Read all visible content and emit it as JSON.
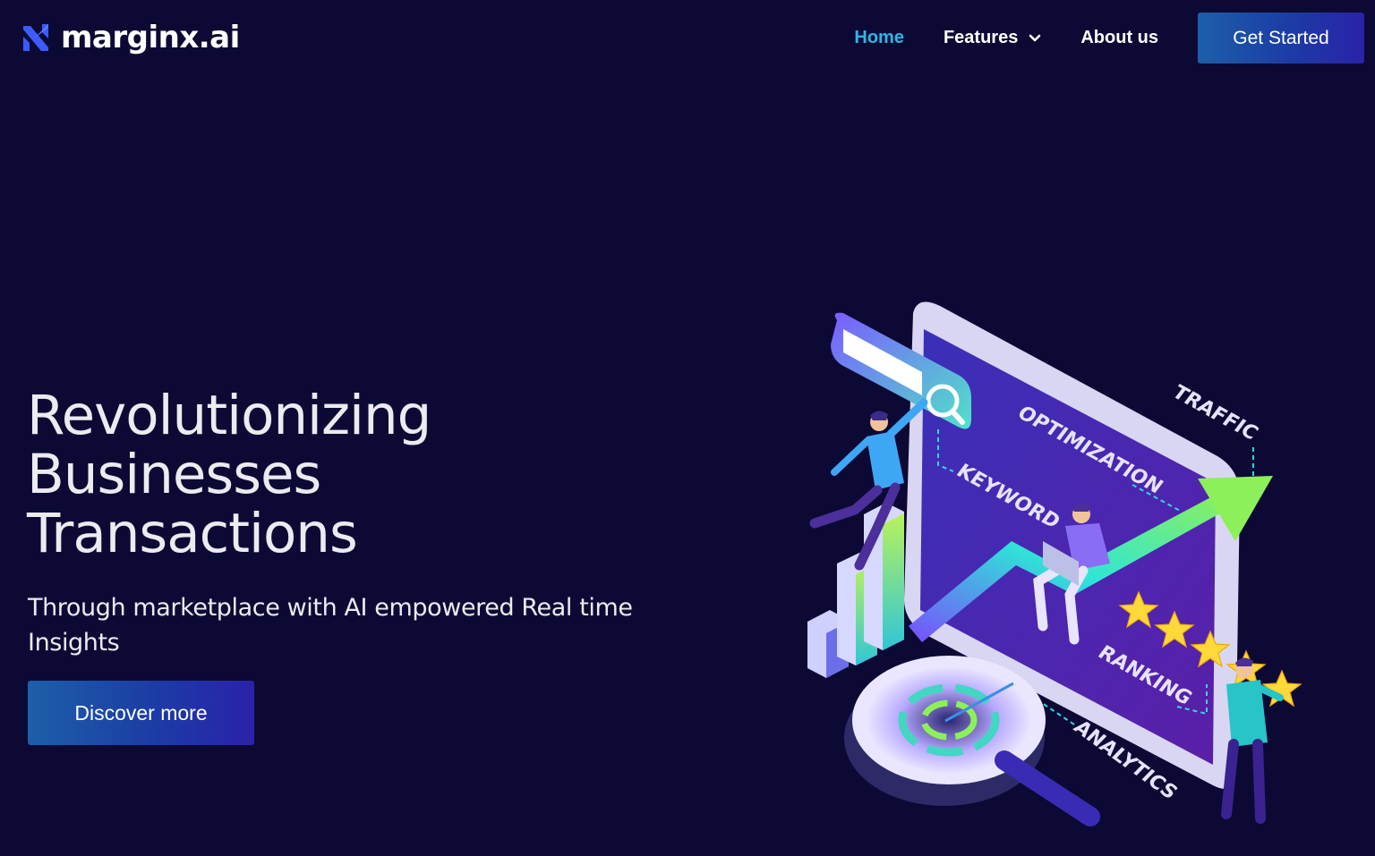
{
  "brand": {
    "name": "marginx.ai",
    "colors": {
      "background": "#0c0a35",
      "accent": "#2fb6e6",
      "button_gradient_start": "#1d5fa8",
      "button_gradient_end": "#2a22a8"
    }
  },
  "nav": {
    "items": [
      {
        "label": "Home",
        "active": true
      },
      {
        "label": "Features",
        "active": false,
        "icon": "chevron-down-icon"
      },
      {
        "label": "About us",
        "active": false
      }
    ],
    "cta_label": "Get Started"
  },
  "hero": {
    "title_lines": [
      "Revolutionizing",
      "Businesses",
      "Transactions"
    ],
    "subtitle": "Through marketplace with AI empowered Real time Insights",
    "cta_label": "Discover more"
  },
  "illustration": {
    "labels": {
      "optimization": "OPTIMIZATION",
      "traffic": "TRAFFIC",
      "keyword": "KEYWORD",
      "ranking": "RANKING",
      "analytics": "ANALYTICS"
    }
  }
}
